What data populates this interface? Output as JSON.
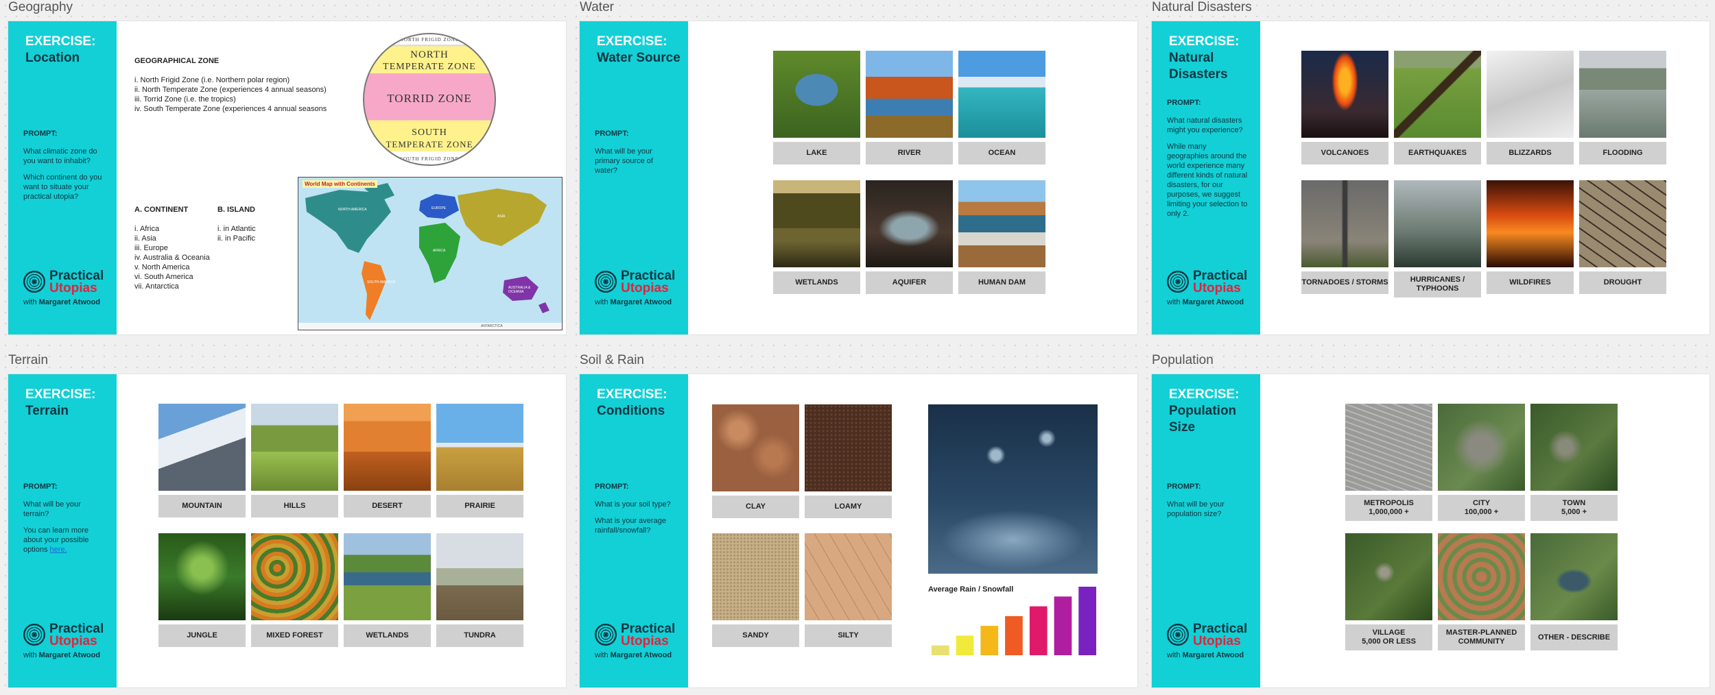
{
  "frames": [
    {
      "title": "Geography",
      "exercise_label": "EXERCISE:",
      "exercise_name": "Location",
      "prompt_head": "PROMPT:",
      "prompt_lines": [
        "What climatic zone do you want to inhabit?",
        "Which continent do you want to situate your practical utopia?"
      ],
      "zone_heading": "GEOGRAPHICAL ZONE",
      "zones": [
        "i.  North Frigid Zone (i.e. Northern polar region)",
        "ii. North Temperate Zone (experiences 4 annual seasons)",
        "iii. Torrid Zone (i.e. the tropics)",
        "iv. South Temperate Zone (experiences 4 annual seasons"
      ],
      "continent_heading": "A. CONTINENT",
      "continents": [
        "i. Africa",
        "ii. Asia",
        "iii. Europe",
        "iv. Australia & Oceania",
        "v. North America",
        "vi. South America",
        "vii. Antarctica"
      ],
      "island_heading": "B. ISLAND",
      "islands": [
        "i. in Atlantic",
        "ii. in Pacific"
      ],
      "globe_labels": [
        "NORTH FRIGID ZONE",
        "NORTH",
        "TEMPERATE ZONE",
        "TORRID ZONE",
        "SOUTH",
        "TEMPERATE ZONE",
        "SOUTH FRIGID ZONE"
      ],
      "map_title": "World Map with Continents",
      "map_labels": [
        "NORTH AMERICA",
        "SOUTH AMERICA",
        "EUROPE",
        "AFRICA",
        "ASIA",
        "AUSTRALIA & OCEANIA",
        "ANTARCTICA"
      ]
    },
    {
      "title": "Water",
      "exercise_label": "EXERCISE:",
      "exercise_name": "Water Source",
      "prompt_head": "PROMPT:",
      "prompt_lines": [
        "What will be your primary source of water?"
      ],
      "tiles": [
        "LAKE",
        "RIVER",
        "OCEAN",
        "WETLANDS",
        "AQUIFER",
        "HUMAN DAM"
      ]
    },
    {
      "title": "Natural Disasters",
      "exercise_label": "EXERCISE:",
      "exercise_name": "Natural Disasters",
      "prompt_head": "PROMPT:",
      "prompt_lines": [
        "What natural disasters might you experience?",
        "While many geographies around the world experience many different kinds of natural disasters, for our purposes, we suggest limiting your selection to only 2."
      ],
      "tiles": [
        "VOLCANOES",
        "EARTHQUAKES",
        "BLIZZARDS",
        "FLOODING",
        "TORNADOES / STORMS",
        "HURRICANES /\nTYPHOONS",
        "WILDFIRES",
        "DROUGHT"
      ]
    },
    {
      "title": "Terrain",
      "exercise_label": "EXERCISE:",
      "exercise_name": "Terrain",
      "prompt_head": "PROMPT:",
      "prompt_lines": [
        "What will be your terrain?",
        "You can learn more about your possible options"
      ],
      "prompt_link": "here.",
      "tiles": [
        "MOUNTAIN",
        "HILLS",
        "DESERT",
        "PRAIRIE",
        "JUNGLE",
        "MIXED FOREST",
        "WETLANDS",
        "TUNDRA"
      ]
    },
    {
      "title": "Soil & Rain",
      "exercise_label": "EXERCISE:",
      "exercise_name": "Conditions",
      "prompt_head": "PROMPT:",
      "prompt_lines": [
        "What is your soil type?",
        "What is your average rainfall/snowfall?"
      ],
      "tiles": [
        "CLAY",
        "LOAMY",
        "SANDY",
        "SILTY"
      ],
      "chart_title": "Average Rain / Snowfall"
    },
    {
      "title": "Population",
      "exercise_label": "EXERCISE:",
      "exercise_name": "Population Size",
      "prompt_head": "PROMPT:",
      "prompt_lines": [
        "What will be your population size?"
      ],
      "tiles": [
        "METROPOLIS\n1,000,000 +",
        "CITY\n100,000 +",
        "TOWN\n5,000 +",
        "VILLAGE\n5,000 OR LESS",
        "MASTER-PLANNED\nCOMMUNITY",
        "OTHER - DESCRIBE"
      ]
    }
  ],
  "logo": {
    "line1": "Practical",
    "line2": "Utopias",
    "with_prefix": "with ",
    "with_name": "Margaret Atwood"
  },
  "colors": {
    "sidebar": "#12d0d6",
    "heading_dark": "#113540",
    "logo_red": "#e6213a",
    "label_bg": "#d0d0d0"
  },
  "chart_data": {
    "type": "bar",
    "title": "Average Rain / Snowfall",
    "categories": [
      "1",
      "2",
      "3",
      "4",
      "5",
      "6",
      "7"
    ],
    "values": [
      1,
      2,
      3,
      4,
      5,
      6,
      7
    ],
    "colors": [
      "#e8e070",
      "#f0ea3a",
      "#f5b81a",
      "#ee5b23",
      "#e01a6a",
      "#b01ea0",
      "#7a22c0"
    ],
    "xlabel": "",
    "ylabel": "",
    "grid": false
  }
}
